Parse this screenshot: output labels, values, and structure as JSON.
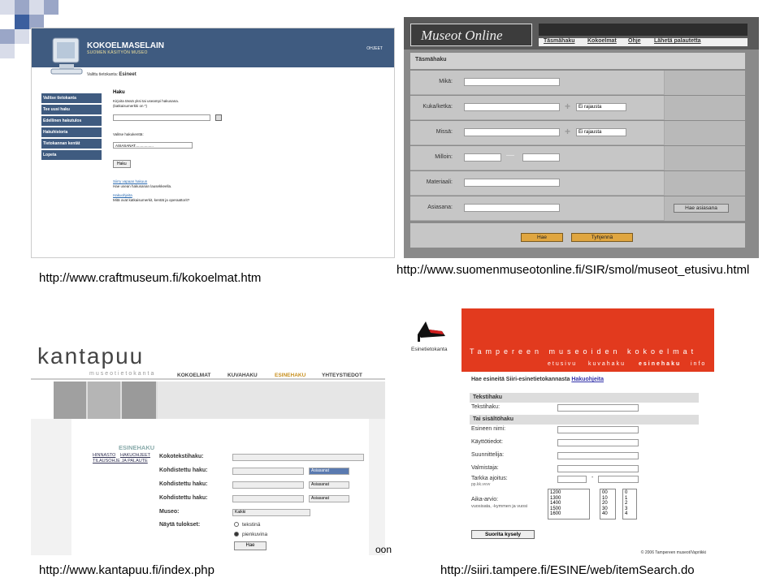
{
  "slide": {
    "accent_colors": [
      "#3b5e9e",
      "#9aa6c7",
      "#d8dce9"
    ]
  },
  "captions": {
    "c1": "http://www.craftmuseum.fi/kokoelmat.htm",
    "c2": "http://www.suomenmuseotonline.fi/SIR/smol/museot_etusivu.html",
    "c3": "http://www.kantapuu.fi/index.php",
    "c4": "http://siiri.tampere.fi/ESINE/web/itemSearch.do",
    "fragment": "oon"
  },
  "p1": {
    "title": "KOKOELMASELAIN",
    "subtitle": "SUOMEN KÄSITYÖN MUSEO",
    "help": "OHJEET",
    "crumb_prefix": "Valittu tietokanta:",
    "crumb_value": "Esineet",
    "nav": [
      "Valitse tietokanta",
      "Tee uusi haku",
      "Edellinen hakutulos",
      "Hakuhistoria",
      "Tietokannan kentät",
      "Lopeta"
    ],
    "haku": "Haku",
    "instr1": "Kirjoita tässä yksi tai useampi hakusana.",
    "instr2": "(katkaisumerkki on *)",
    "field_label": "Valitse hakukenttä:",
    "field_value": "ASIASANAT..................",
    "button": "Haku",
    "link1": "Siirry vapaan hakuun",
    "link1_desc": "Hae usean hakusanan lausekkeella.",
    "link2": "Hakuohjeita",
    "link2_desc": "Mitä ovat katkaisumerkit, kentät ja operaattorit?"
  },
  "p2": {
    "brand": "Museot Online",
    "menu": [
      "Täsmähaku",
      "Kokoelmat",
      "Ohje",
      "Lähetä palautetta"
    ],
    "section": "Täsmähaku",
    "labels": [
      "Mikä:",
      "Kuka/ketka:",
      "Missä:",
      "Milloin:",
      "Materiaali:",
      "Asiasana:"
    ],
    "dropdown": "Ei rajausta",
    "dash": "—",
    "plus": "+",
    "btn_asiasana": "Hae asiasana",
    "btn_hae": "Hae",
    "btn_tyhjenna": "Tyhjennä"
  },
  "p3": {
    "brand": "kantapuu",
    "sub": "museotietokanta",
    "nav": [
      "KOKOELMAT",
      "KUVAHAKU",
      "ESINEHAKU",
      "YHTEYSTIEDOT"
    ],
    "page": "ESINEHAKU",
    "links": [
      "HINNASTO",
      "HAKUOHJEET",
      "TILAUSOHJE JA PALAUTE"
    ],
    "fields": [
      "Kokotekstihaku:",
      "Kohdistettu haku:",
      "Kohdistettu haku:",
      "Kohdistettu haku:",
      "Museo:",
      "Näytä tulokset:"
    ],
    "sel": "Asiasanat",
    "museo": "Kaikki",
    "radio1": "tekstinä",
    "radio2": "pienkuvina",
    "button": "Hae"
  },
  "p4": {
    "logo": "Esinetietokanta",
    "title": "Tampereen museoiden kokoelmat",
    "menu": [
      "etusivu",
      "kuvahaku",
      "esinehaku",
      "info"
    ],
    "heading": "Hae esineitä Siiri-esinetietokannasta",
    "help": "Hakuohjeita",
    "g1": "Tekstihaku",
    "f_teksti": "Tekstihaku:",
    "g2": "Tai sisältöhaku",
    "fields": [
      "Esineen nimi:",
      "Käyttötiedot:",
      "Suunnittelija:",
      "Valmistaja:",
      "Tarkka ajoitus:"
    ],
    "ajoitus_hint": "pp.kk.vvvv",
    "dash": "-",
    "arvio": "Aika-arvio:",
    "arvio_hint": "vuosisata, -kymmen ja vuosi",
    "years": [
      "1200",
      "1300",
      "1400",
      "1500",
      "1600"
    ],
    "decades": [
      "00",
      "10",
      "20",
      "30",
      "40"
    ],
    "units": [
      "0",
      "1",
      "2",
      "3",
      "4"
    ],
    "button": "Suorita kysely",
    "footer": "© 2006 Tampereen museot/Vapriikki"
  }
}
